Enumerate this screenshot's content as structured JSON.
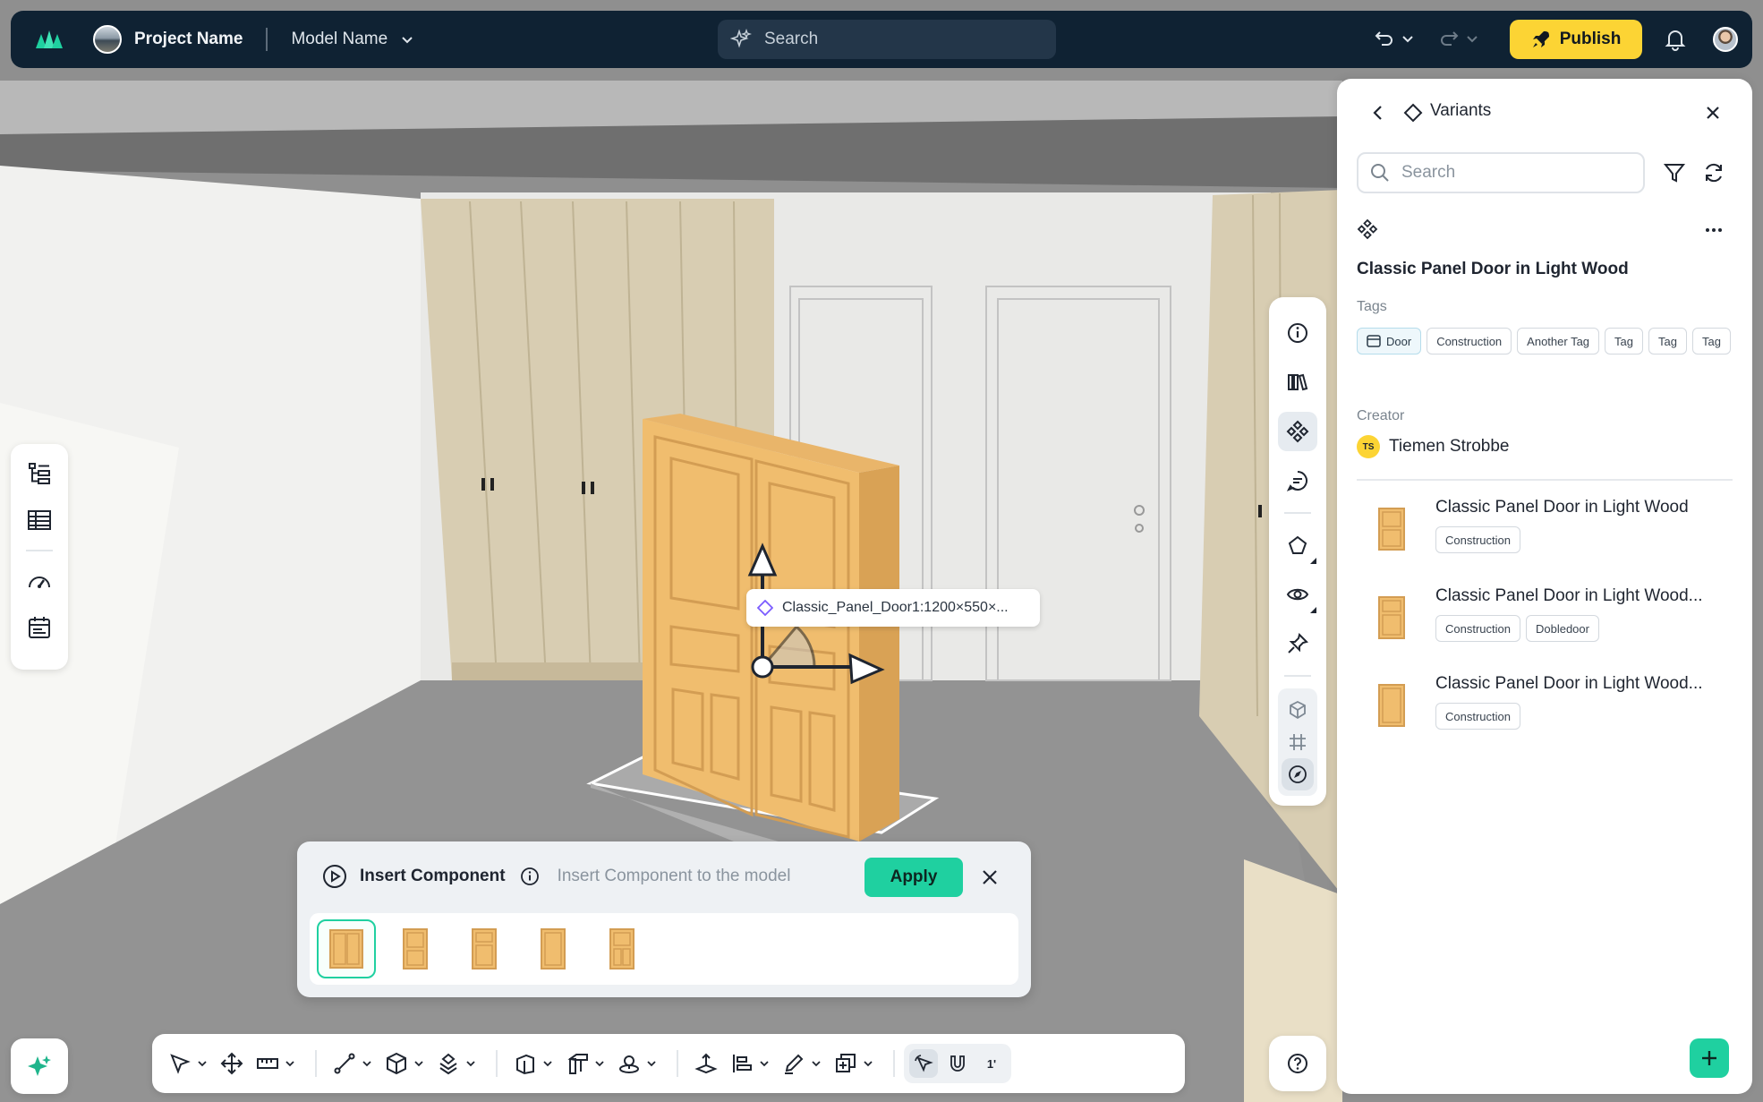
{
  "header": {
    "project_name": "Project Name",
    "model_name": "Model Name",
    "search_placeholder": "Search",
    "publish_label": "Publish"
  },
  "object_label": "Classic_Panel_Door1:1200×550×...",
  "insert_panel": {
    "title": "Insert Component",
    "description": "Insert Component to the model",
    "apply_label": "Apply"
  },
  "variants_panel": {
    "title": "Variants",
    "search_placeholder": "Search",
    "component_name": "Classic Panel Door in Light Wood",
    "tags_label": "Tags",
    "tags": [
      "Door",
      "Construction",
      "Another Tag",
      "Tag",
      "Tag",
      "Tag"
    ],
    "creator_label": "Creator",
    "creator_initials": "TS",
    "creator_name": "Tiemen Strobbe",
    "items": [
      {
        "name": "Classic Panel Door in Light Wood",
        "tags": [
          "Construction"
        ]
      },
      {
        "name": "Classic Panel Door in Light Wood...",
        "tags": [
          "Construction",
          "Dobledoor"
        ]
      },
      {
        "name": "Classic Panel Door in Light Wood...",
        "tags": [
          "Construction"
        ]
      }
    ]
  },
  "snap_label": "1'",
  "colors": {
    "accent": "#1fd0a0",
    "publish": "#fcd434",
    "topbar": "#0f2233",
    "door_wood": "#f0bd6e"
  }
}
